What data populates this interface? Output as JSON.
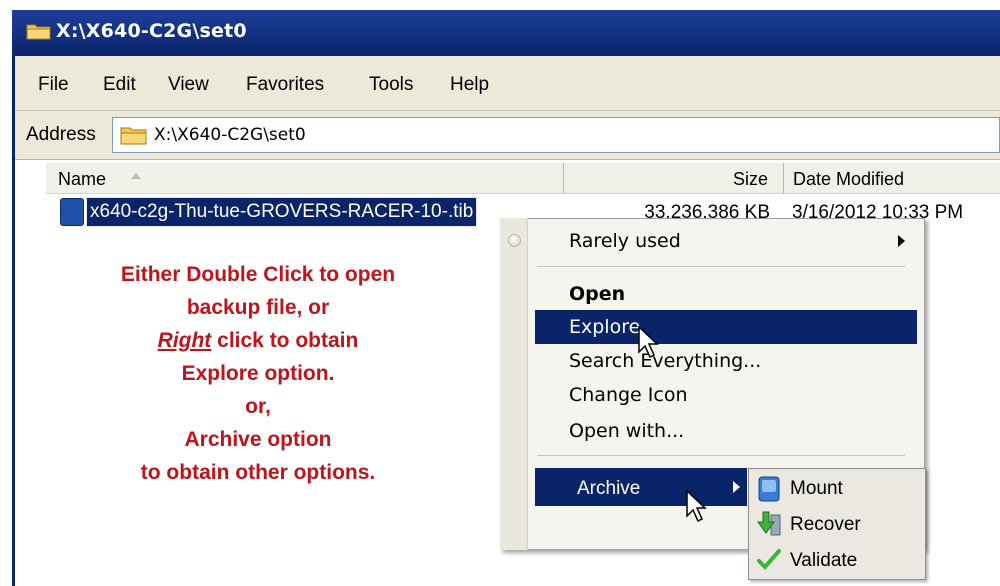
{
  "window": {
    "title": "X:\\X640-C2G\\set0"
  },
  "menu": {
    "items": [
      "File",
      "Edit",
      "View",
      "Favorites",
      "Tools",
      "Help"
    ]
  },
  "address": {
    "label": "Address",
    "value": "X:\\X640-C2G\\set0"
  },
  "list": {
    "columns": {
      "name": "Name",
      "size": "Size",
      "date": "Date Modified"
    },
    "rows": [
      {
        "name": "x640-c2g-Thu-tue-GROVERS-RACER-10-.tib",
        "size": "33,236,386 KB",
        "date": "3/16/2012 10:33 PM"
      }
    ]
  },
  "instructions": {
    "line1": "Either Double Click to open",
    "line2": "backup file, or",
    "line3_em": "Right",
    "line3_rest": " click to obtain",
    "line4": "Explore option.",
    "line5": "or,",
    "line6": "Archive option",
    "line7": "to obtain other options."
  },
  "context_menu": {
    "items": [
      "Rarely used",
      "Open",
      "Explore",
      "Search Everything...",
      "Change Icon",
      "Open with...",
      "Archive"
    ],
    "highlighted": "Explore"
  },
  "archive_submenu": {
    "items": [
      {
        "label": "Mount",
        "icon": "mount-disk-icon"
      },
      {
        "label": "Recover",
        "icon": "recover-arrow-icon"
      },
      {
        "label": "Validate",
        "icon": "validate-check-icon"
      }
    ]
  },
  "colors": {
    "titlebar": "#0a246a",
    "selection": "#0a246a",
    "instruction_text": "#c0141c",
    "menu_bg": "#ece9d8"
  }
}
